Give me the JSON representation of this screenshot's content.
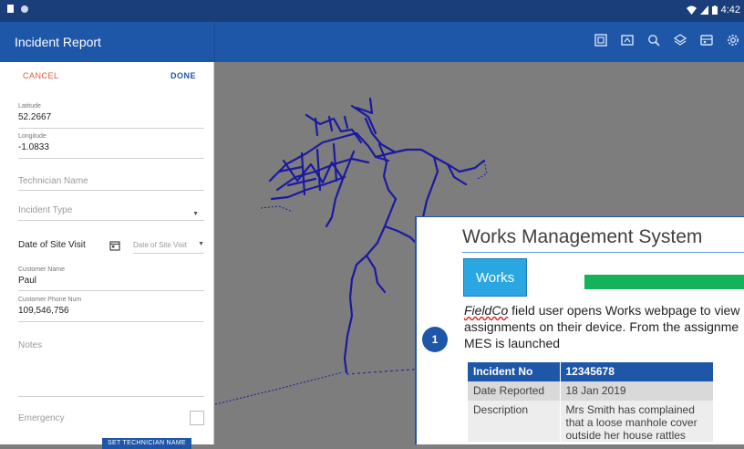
{
  "status_bar": {
    "time": "4:42",
    "left_icons": [
      "sd-card-icon",
      "circle-icon"
    ],
    "right_icons": [
      "wifi-icon",
      "signal-icon",
      "battery-icon"
    ]
  },
  "app_bar": {
    "title": "Incident Report",
    "toolbar_icons": [
      "layer-select-icon",
      "map-export-icon",
      "search-icon",
      "layers-icon",
      "basemap-icon",
      "settings-icon"
    ]
  },
  "form": {
    "cancel_label": "CANCEL",
    "done_label": "DONE",
    "latitude": {
      "label": "Latitude",
      "value": "52.2667"
    },
    "longitude": {
      "label": "Longitude",
      "value": "-1.0833"
    },
    "technician_name": {
      "placeholder": "Technician Name"
    },
    "incident_type": {
      "placeholder": "Incident Type"
    },
    "date_of_site_visit": {
      "label": "Date of Site Visit",
      "placeholder": "Date of Site Visit"
    },
    "customer_name": {
      "label": "Customer Name",
      "value": "Paul"
    },
    "customer_phone": {
      "label": "Customer Phone Num",
      "value": "109,546,756"
    },
    "notes": {
      "placeholder": "Notes"
    },
    "emergency": {
      "label": "Emergency",
      "checked": false
    },
    "set_technician_label": "SET TECHNICIAN NAME"
  },
  "map": {
    "network_color": "#1a1aa0",
    "background": "#7d7d7d"
  },
  "wms_card": {
    "title": "Works Management System",
    "works_button": "Works",
    "step_number": "1",
    "description_italic": "FieldCo",
    "description_line1": " field user opens Works webpage to view",
    "description_line2": "assignments on their device. From the assignme",
    "description_line3": "MES is launched",
    "table": {
      "header": [
        "Incident No",
        "12345678"
      ],
      "rows": [
        [
          "Date Reported",
          "18 Jan 2019"
        ],
        [
          "Description",
          "Mrs Smith has complained that a loose manhole cover outside her house rattles"
        ]
      ]
    }
  }
}
